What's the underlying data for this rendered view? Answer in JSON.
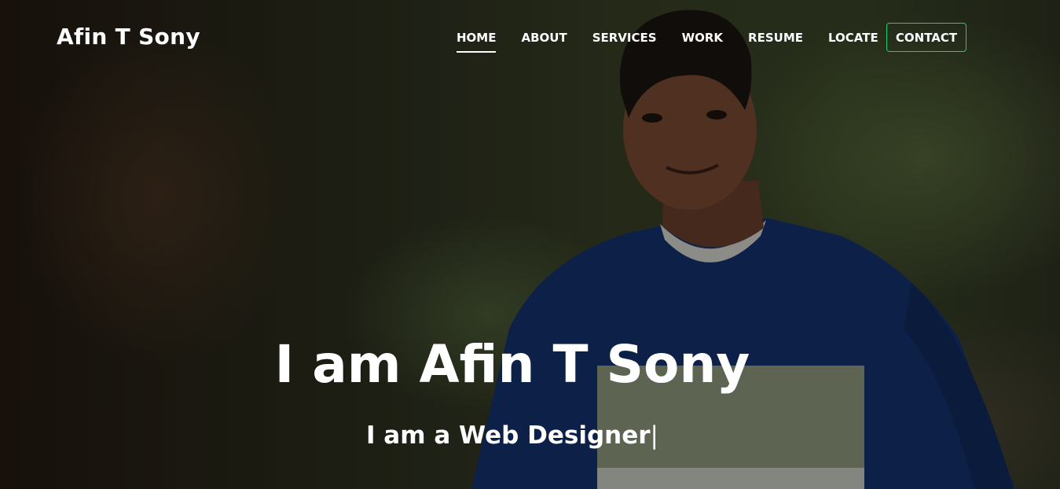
{
  "brand": {
    "name": "Afin T Sony"
  },
  "nav": {
    "items": [
      {
        "label": "HOME",
        "active": true
      },
      {
        "label": "ABOUT",
        "active": false
      },
      {
        "label": "SERVICES",
        "active": false
      },
      {
        "label": "WORK",
        "active": false
      },
      {
        "label": "RESUME",
        "active": false
      },
      {
        "label": "LOCATE",
        "active": false
      }
    ],
    "cta": "CONTACT"
  },
  "hero": {
    "title": "I am Afin T Sony",
    "subtitle": "I am a Web Designer",
    "cursor": "|"
  },
  "colors": {
    "accent": "#18d26e",
    "text": "#ffffff",
    "shirt_blue": "#14336f",
    "shirt_stripe": "#8f9b7e"
  }
}
